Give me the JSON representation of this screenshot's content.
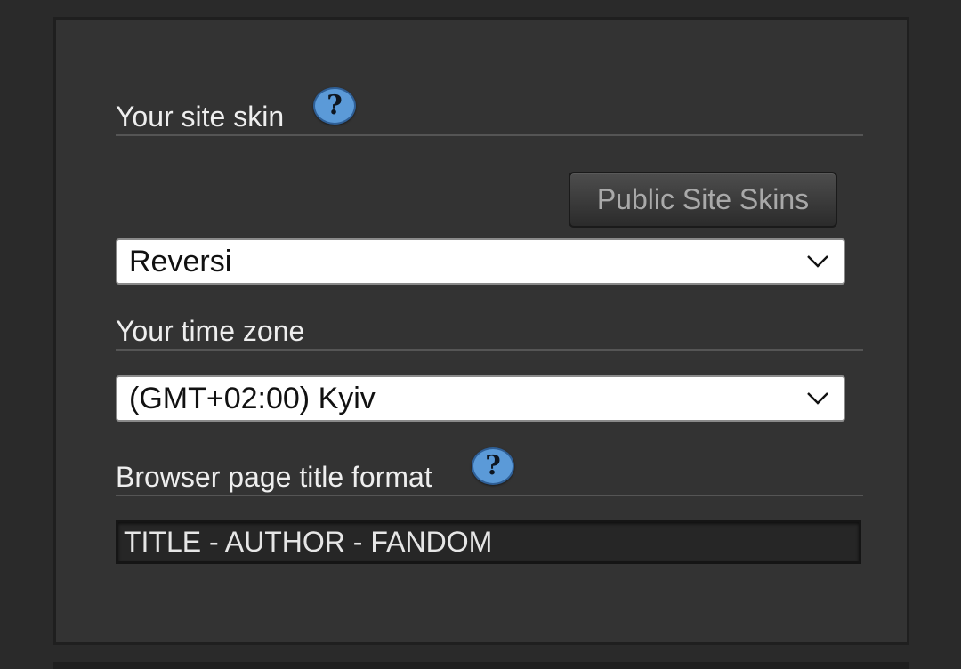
{
  "site_skin": {
    "heading": "Your site skin",
    "help_symbol": "?",
    "help_icon": "help-question-icon",
    "public_skins_button": "Public Site Skins",
    "selected": "Reversi"
  },
  "time_zone": {
    "heading": "Your time zone",
    "selected": "(GMT+02:00) Kyiv"
  },
  "title_format": {
    "heading": "Browser page title format",
    "help_symbol": "?",
    "help_icon": "help-question-icon",
    "value": "TITLE - AUTHOR - FANDOM"
  },
  "colors": {
    "page_background": "#2a2a2a",
    "panel_background": "#333333",
    "help_icon_blue": "#5b9ad8",
    "text": "#eeeeee"
  }
}
